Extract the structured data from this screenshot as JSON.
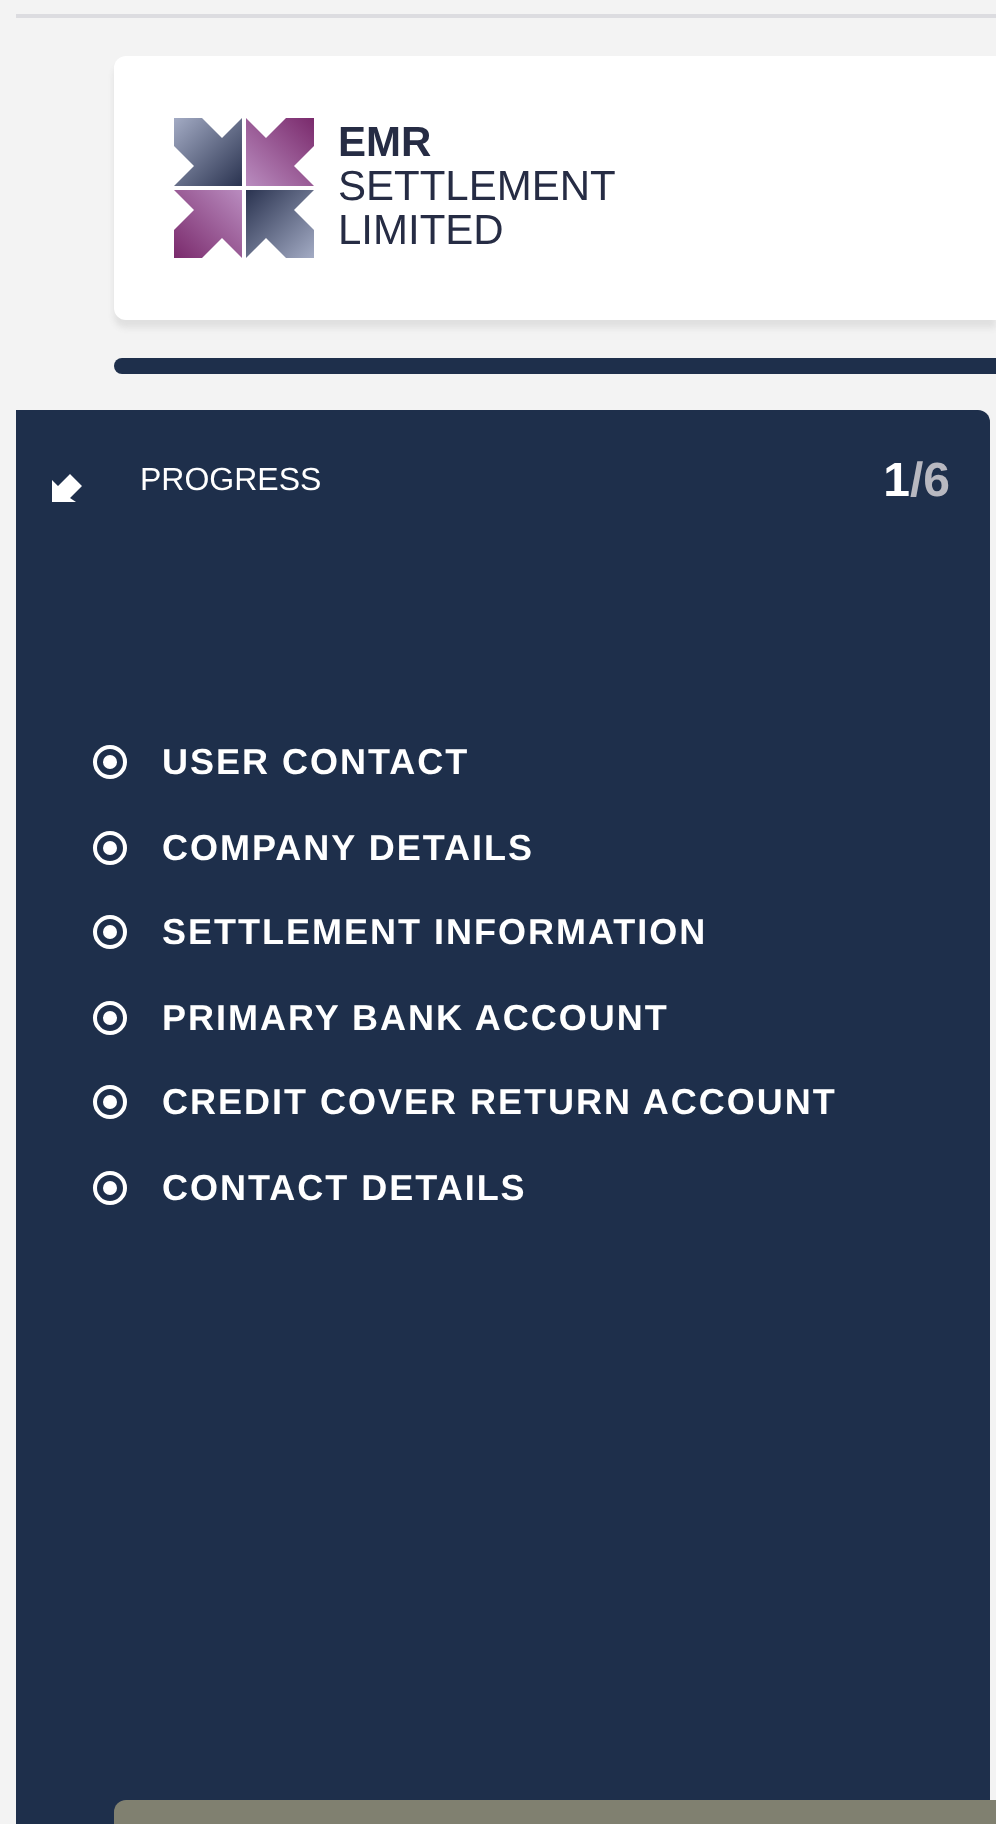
{
  "logo": {
    "line_1": "EMR",
    "line_2": "SETTLEMENT",
    "line_3": "LIMITED"
  },
  "progress": {
    "title": "PROGRESS",
    "current": "1",
    "total": "/6"
  },
  "steps": [
    {
      "label": "USER CONTACT"
    },
    {
      "label": "COMPANY DETAILS"
    },
    {
      "label": "SETTLEMENT INFORMATION"
    },
    {
      "label": "PRIMARY BANK ACCOUNT"
    },
    {
      "label": "CREDIT COVER RETURN ACCOUNT"
    },
    {
      "label": "CONTACT DETAILS"
    }
  ]
}
